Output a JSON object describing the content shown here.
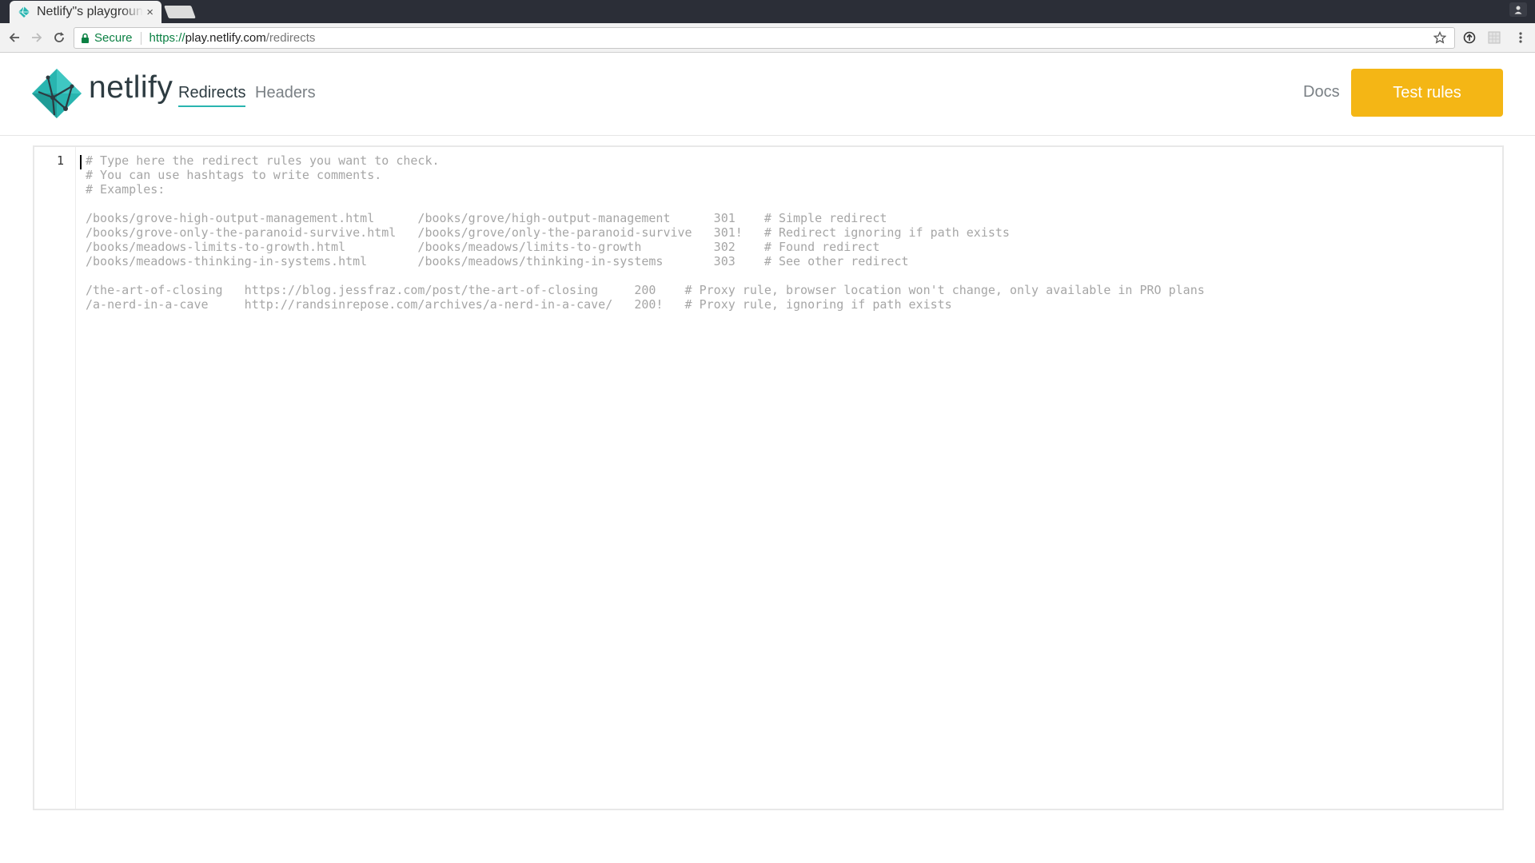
{
  "browser": {
    "tab_title": "Netlify\"s playground",
    "tab_close": "×",
    "secure_label": "Secure",
    "url_scheme": "https://",
    "url_host": "play.netlify.com",
    "url_path": "/redirects"
  },
  "header": {
    "brand": "netlify",
    "tabs": [
      {
        "label": "Redirects",
        "active": true
      },
      {
        "label": "Headers",
        "active": false
      }
    ],
    "docs_label": "Docs",
    "test_button_label": "Test rules"
  },
  "editor": {
    "line_number": "1",
    "lines": [
      "# Type here the redirect rules you want to check.",
      "# You can use hashtags to write comments.",
      "# Examples:",
      "",
      "/books/grove-high-output-management.html      /books/grove/high-output-management      301    # Simple redirect",
      "/books/grove-only-the-paranoid-survive.html   /books/grove/only-the-paranoid-survive   301!   # Redirect ignoring if path exists",
      "/books/meadows-limits-to-growth.html          /books/meadows/limits-to-growth          302    # Found redirect",
      "/books/meadows-thinking-in-systems.html       /books/meadows/thinking-in-systems       303    # See other redirect",
      "",
      "/the-art-of-closing   https://blog.jessfraz.com/post/the-art-of-closing     200    # Proxy rule, browser location won't change, only available in PRO plans",
      "/a-nerd-in-a-cave     http://randsinrepose.com/archives/a-nerd-in-a-cave/   200!   # Proxy rule, ignoring if path exists"
    ]
  },
  "colors": {
    "accent_teal": "#29b5b0",
    "button_yellow": "#f4b615",
    "text_dark": "#2d3b41",
    "secure_green": "#0b8043"
  }
}
